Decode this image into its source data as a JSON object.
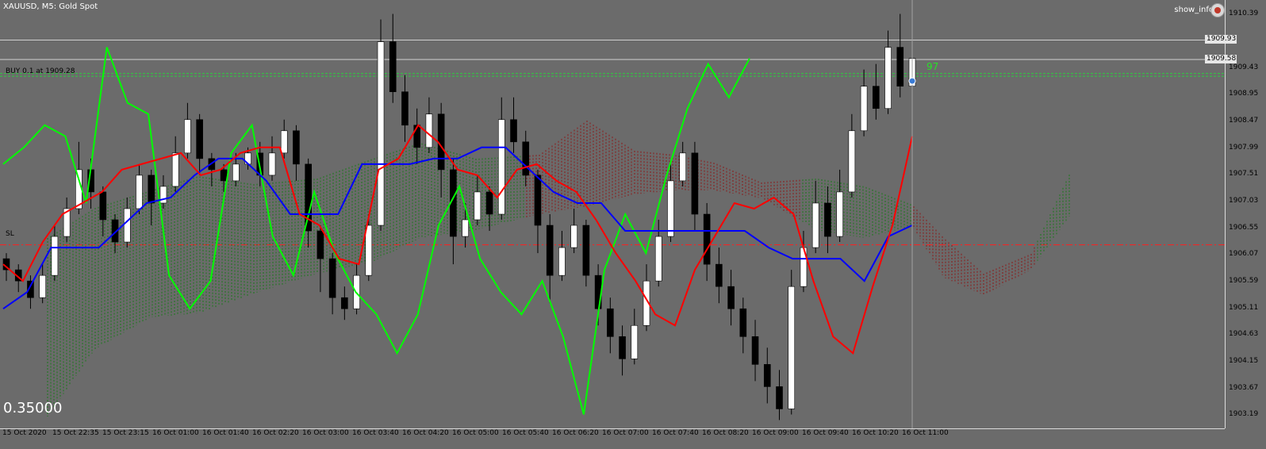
{
  "window": {
    "title": "XAUUSD, M5:  Gold Spot",
    "show_info_label": "show_info"
  },
  "labels": {
    "buy_order": "BUY 0.1 at 1909.28",
    "stop_loss": "SL",
    "indicator_value": "0.35000",
    "trade_count": "97"
  },
  "price_axis": {
    "ticks": [
      "1910.39",
      "1909.43",
      "1908.95",
      "1908.47",
      "1907.99",
      "1907.51",
      "1907.03",
      "1906.55",
      "1906.07",
      "1905.59",
      "1905.11",
      "1904.63",
      "1904.15",
      "1903.67",
      "1903.19"
    ],
    "markers": [
      "1909.93",
      "1909.58"
    ]
  },
  "time_axis": {
    "ticks": [
      "15 Oct 2020",
      "15 Oct 22:35",
      "15 Oct 23:15",
      "16 Oct 01:00",
      "16 Oct 01:40",
      "16 Oct 02:20",
      "16 Oct 03:00",
      "16 Oct 03:40",
      "16 Oct 04:20",
      "16 Oct 05:00",
      "16 Oct 05:40",
      "16 Oct 06:20",
      "16 Oct 07:00",
      "16 Oct 07:40",
      "16 Oct 08:20",
      "16 Oct 09:00",
      "16 Oct 09:40",
      "16 Oct 10:20",
      "16 Oct 11:00"
    ]
  },
  "colors": {
    "background": "#6b6b6b",
    "bull_candle": "#ffffff",
    "bear_candle": "#000000",
    "tenkan": "#ff0000",
    "kijun": "#0000ff",
    "chikou": "#00ff00",
    "cloud_bull": "#1a7a1a",
    "cloud_bear": "#8b1a1a"
  },
  "chart_data": {
    "type": "candlestick",
    "symbol": "XAUUSD",
    "timeframe": "M5",
    "ylim": [
      1902.95,
      1910.65
    ],
    "levels": {
      "top_line": 1909.93,
      "current": 1909.58,
      "buy": 1909.28,
      "buy_upper": 1909.33,
      "stop_loss": 1906.25
    },
    "candles": [
      [
        1906.0,
        1905.8,
        1906.1,
        1905.6
      ],
      [
        1905.8,
        1905.6,
        1905.9,
        1905.4
      ],
      [
        1905.6,
        1905.3,
        1905.7,
        1905.1
      ],
      [
        1905.3,
        1905.7,
        1905.9,
        1905.2
      ],
      [
        1905.7,
        1906.4,
        1906.6,
        1905.6
      ],
      [
        1906.4,
        1906.9,
        1907.1,
        1906.3
      ],
      [
        1906.9,
        1907.6,
        1908.1,
        1906.8
      ],
      [
        1907.6,
        1907.2,
        1907.8,
        1906.9
      ],
      [
        1907.2,
        1906.7,
        1907.3,
        1906.4
      ],
      [
        1906.7,
        1906.3,
        1906.8,
        1906.1
      ],
      [
        1906.3,
        1906.9,
        1907.1,
        1906.2
      ],
      [
        1906.9,
        1907.5,
        1907.7,
        1906.8
      ],
      [
        1907.5,
        1907.0,
        1907.6,
        1906.6
      ],
      [
        1907.0,
        1907.3,
        1907.5,
        1906.9
      ],
      [
        1907.3,
        1907.9,
        1908.2,
        1907.2
      ],
      [
        1907.9,
        1908.5,
        1908.8,
        1907.8
      ],
      [
        1908.5,
        1907.8,
        1908.6,
        1907.5
      ],
      [
        1907.8,
        1907.6,
        1907.9,
        1907.3
      ],
      [
        1907.6,
        1907.4,
        1907.7,
        1907.2
      ],
      [
        1907.4,
        1907.7,
        1907.9,
        1907.3
      ],
      [
        1907.7,
        1907.9,
        1908.0,
        1907.6
      ],
      [
        1907.9,
        1907.5,
        1908.1,
        1907.3
      ],
      [
        1907.5,
        1907.9,
        1908.2,
        1907.4
      ],
      [
        1907.9,
        1908.3,
        1908.5,
        1907.8
      ],
      [
        1908.3,
        1907.7,
        1908.4,
        1907.4
      ],
      [
        1907.7,
        1906.5,
        1907.8,
        1906.2
      ],
      [
        1906.5,
        1906.0,
        1906.6,
        1905.4
      ],
      [
        1906.0,
        1905.3,
        1906.1,
        1905.0
      ],
      [
        1905.3,
        1905.1,
        1905.5,
        1904.9
      ],
      [
        1905.1,
        1905.7,
        1905.9,
        1905.0
      ],
      [
        1905.7,
        1906.6,
        1906.8,
        1905.6
      ],
      [
        1906.6,
        1909.9,
        1910.3,
        1906.5
      ],
      [
        1909.9,
        1909.0,
        1910.4,
        1908.8
      ],
      [
        1909.0,
        1908.4,
        1909.3,
        1908.1
      ],
      [
        1908.4,
        1908.0,
        1908.7,
        1907.7
      ],
      [
        1908.0,
        1908.6,
        1908.9,
        1907.9
      ],
      [
        1908.6,
        1907.6,
        1908.8,
        1907.1
      ],
      [
        1907.6,
        1906.4,
        1907.8,
        1905.9
      ],
      [
        1906.4,
        1906.7,
        1907.0,
        1906.2
      ],
      [
        1906.7,
        1907.2,
        1907.5,
        1906.6
      ],
      [
        1907.2,
        1906.8,
        1907.3,
        1906.5
      ],
      [
        1906.8,
        1908.5,
        1908.9,
        1906.7
      ],
      [
        1908.5,
        1908.1,
        1908.9,
        1907.9
      ],
      [
        1908.1,
        1907.5,
        1908.3,
        1907.3
      ],
      [
        1907.5,
        1906.6,
        1907.6,
        1906.1
      ],
      [
        1906.6,
        1905.7,
        1906.8,
        1905.2
      ],
      [
        1905.7,
        1906.2,
        1906.5,
        1905.6
      ],
      [
        1906.2,
        1906.6,
        1906.9,
        1906.1
      ],
      [
        1906.6,
        1905.7,
        1906.7,
        1905.5
      ],
      [
        1905.7,
        1905.1,
        1905.9,
        1904.8
      ],
      [
        1905.1,
        1904.6,
        1905.3,
        1904.3
      ],
      [
        1904.6,
        1904.2,
        1904.8,
        1903.9
      ],
      [
        1904.2,
        1904.8,
        1905.1,
        1904.1
      ],
      [
        1904.8,
        1905.6,
        1905.9,
        1904.7
      ],
      [
        1905.6,
        1906.4,
        1906.7,
        1905.5
      ],
      [
        1906.4,
        1907.4,
        1907.7,
        1906.3
      ],
      [
        1907.4,
        1907.9,
        1908.1,
        1907.3
      ],
      [
        1907.9,
        1906.8,
        1908.1,
        1906.5
      ],
      [
        1906.8,
        1905.9,
        1907.0,
        1905.6
      ],
      [
        1905.9,
        1905.5,
        1906.2,
        1905.2
      ],
      [
        1905.5,
        1905.1,
        1905.8,
        1904.8
      ],
      [
        1905.1,
        1904.6,
        1905.3,
        1904.3
      ],
      [
        1904.6,
        1904.1,
        1904.9,
        1903.8
      ],
      [
        1904.1,
        1903.7,
        1904.4,
        1903.4
      ],
      [
        1903.7,
        1903.3,
        1904.0,
        1903.1
      ],
      [
        1903.3,
        1905.5,
        1905.8,
        1903.2
      ],
      [
        1905.5,
        1906.2,
        1906.5,
        1905.4
      ],
      [
        1906.2,
        1907.0,
        1907.4,
        1906.1
      ],
      [
        1907.0,
        1906.4,
        1907.3,
        1906.1
      ],
      [
        1906.4,
        1907.2,
        1907.6,
        1906.3
      ],
      [
        1907.2,
        1908.3,
        1908.6,
        1907.1
      ],
      [
        1908.3,
        1909.1,
        1909.4,
        1908.2
      ],
      [
        1909.1,
        1908.7,
        1909.5,
        1908.5
      ],
      [
        1908.7,
        1909.8,
        1910.1,
        1908.6
      ],
      [
        1909.8,
        1909.1,
        1910.4,
        1908.9
      ],
      [
        1909.1,
        1909.6,
        1909.7,
        1908.9
      ]
    ],
    "tenkan_sen": [
      1905.9,
      1905.6,
      1906.3,
      1906.8,
      1907.0,
      1907.2,
      1907.6,
      1907.7,
      1907.8,
      1907.9,
      1907.5,
      1907.6,
      1907.9,
      1908.0,
      1908.0,
      1906.8,
      1906.6,
      1906.0,
      1905.9,
      1907.6,
      1907.8,
      1908.4,
      1908.1,
      1907.6,
      1907.5,
      1907.1,
      1907.6,
      1907.7,
      1907.4,
      1907.2,
      1906.7,
      1906.1,
      1905.6,
      1905.0,
      1904.8,
      1905.8,
      1906.4,
      1907.0,
      1906.9,
      1907.1,
      1906.8,
      1905.6,
      1904.6,
      1904.3,
      1905.5,
      1906.6,
      1908.2
    ],
    "kijun_sen": [
      1905.1,
      1905.4,
      1906.2,
      1906.2,
      1906.2,
      1906.6,
      1907.0,
      1907.1,
      1907.5,
      1907.8,
      1907.8,
      1907.4,
      1906.8,
      1906.8,
      1906.8,
      1907.7,
      1907.7,
      1907.7,
      1907.8,
      1907.8,
      1908.0,
      1908.0,
      1907.6,
      1907.2,
      1907.0,
      1907.0,
      1906.5,
      1906.5,
      1906.5,
      1906.5,
      1906.5,
      1906.5,
      1906.2,
      1906.0,
      1906.0,
      1906.0,
      1905.6,
      1906.4,
      1906.6
    ],
    "chikou_span": [
      1907.7,
      1908.0,
      1908.4,
      1908.2,
      1907.0,
      1909.8,
      1908.8,
      1908.6,
      1905.7,
      1905.1,
      1905.6,
      1907.9,
      1908.4,
      1906.4,
      1905.7,
      1907.2,
      1906.1,
      1905.4,
      1905.0,
      1904.3,
      1905.0,
      1906.6,
      1907.3,
      1906.0,
      1905.4,
      1905.0,
      1905.6,
      1904.6,
      1903.2,
      1905.8,
      1906.8,
      1906.1,
      1907.5,
      1908.7,
      1909.5,
      1908.9,
      1909.6
    ]
  }
}
